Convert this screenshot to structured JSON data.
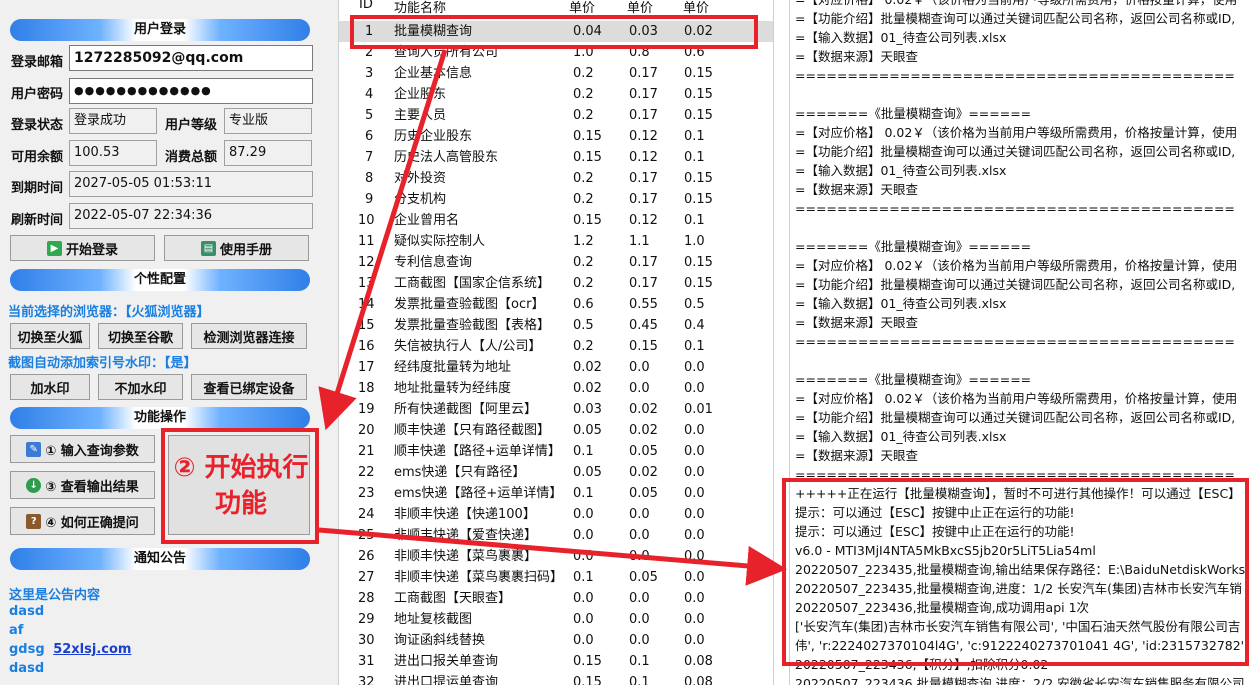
{
  "login": {
    "title": "用户登录",
    "email_label": "登录邮箱",
    "email_value": "1272285092@qq.com",
    "password_label": "用户密码",
    "password_value": "●●●●●●●●●●●●●",
    "status_label": "登录状态",
    "status_value": "登录成功",
    "level_label": "用户等级",
    "level_value": "专业版",
    "balance_label": "可用余额",
    "balance_value": "100.53",
    "spent_label": "消费总额",
    "spent_value": "87.29",
    "expire_label": "到期时间",
    "expire_value": "2027-05-05 01:53:11",
    "refresh_label": "刷新时间",
    "refresh_value": "2022-05-07 22:34:36",
    "start_login_btn": "开始登录",
    "manual_btn": "使用手册"
  },
  "personal": {
    "title": "个性配置",
    "browser_line": "当前选择的浏览器：【火狐浏览器】",
    "switch_firefox": "切换至火狐",
    "switch_chrome": "切换至谷歌",
    "detect_browser": "检测浏览器连接",
    "watermark_line": "截图自动添加索引号水印：【是】",
    "add_watermark": "加水印",
    "no_watermark": "不加水印",
    "view_devices": "查看已绑定设备"
  },
  "functions": {
    "title": "功能操作",
    "input_params": "① 输入查询参数",
    "view_output": "③ 查看输出结果",
    "how_to_ask": "④ 如何正确提问",
    "start_exec": "② 开始执行功能"
  },
  "notice": {
    "title": "通知公告",
    "content_label": "这里是公告内容",
    "lines": [
      "dasd",
      "af",
      "gdsg",
      "dasd"
    ],
    "link": "52xlsj.com"
  },
  "table": {
    "headers": [
      "ID",
      "功能名称",
      "单价",
      "单价",
      "单价"
    ],
    "rows": [
      [
        "1",
        "批量模糊查询",
        "0.04",
        "0.03",
        "0.02"
      ],
      [
        "2",
        "查询人员所有公司",
        "1.0",
        "0.8",
        "0.6"
      ],
      [
        "3",
        "企业基本信息",
        "0.2",
        "0.17",
        "0.15"
      ],
      [
        "4",
        "企业股东",
        "0.2",
        "0.17",
        "0.15"
      ],
      [
        "5",
        "主要人员",
        "0.2",
        "0.17",
        "0.15"
      ],
      [
        "6",
        "历史企业股东",
        "0.15",
        "0.12",
        "0.1"
      ],
      [
        "7",
        "历史法人高管股东",
        "0.15",
        "0.12",
        "0.1"
      ],
      [
        "8",
        "对外投资",
        "0.2",
        "0.17",
        "0.15"
      ],
      [
        "9",
        "分支机构",
        "0.2",
        "0.17",
        "0.15"
      ],
      [
        "10",
        "企业曾用名",
        "0.15",
        "0.12",
        "0.1"
      ],
      [
        "11",
        "疑似实际控制人",
        "1.2",
        "1.1",
        "1.0"
      ],
      [
        "12",
        "专利信息查询",
        "0.2",
        "0.17",
        "0.15"
      ],
      [
        "13",
        "工商截图【国家企信系统】",
        "0.2",
        "0.17",
        "0.15"
      ],
      [
        "14",
        "发票批量查验截图【ocr】",
        "0.6",
        "0.55",
        "0.5"
      ],
      [
        "15",
        "发票批量查验截图【表格】",
        "0.5",
        "0.45",
        "0.4"
      ],
      [
        "16",
        "失信被执行人【人/公司】",
        "0.2",
        "0.15",
        "0.1"
      ],
      [
        "17",
        "经纬度批量转为地址",
        "0.02",
        "0.0",
        "0.0"
      ],
      [
        "18",
        "地址批量转为经纬度",
        "0.02",
        "0.0",
        "0.0"
      ],
      [
        "19",
        "所有快递截图【阿里云】",
        "0.03",
        "0.02",
        "0.01"
      ],
      [
        "20",
        "顺丰快递【只有路径截图】",
        "0.05",
        "0.02",
        "0.0"
      ],
      [
        "21",
        "顺丰快递【路径+运单详情】",
        "0.1",
        "0.05",
        "0.0"
      ],
      [
        "22",
        "ems快递【只有路径】",
        "0.05",
        "0.02",
        "0.0"
      ],
      [
        "23",
        "ems快递【路径+运单详情】",
        "0.1",
        "0.05",
        "0.0"
      ],
      [
        "24",
        "非顺丰快递【快递100】",
        "0.0",
        "0.0",
        "0.0"
      ],
      [
        "25",
        "非顺丰快递【爱查快递】",
        "0.0",
        "0.0",
        "0.0"
      ],
      [
        "26",
        "非顺丰快递【菜鸟裹裹】",
        "0.0",
        "0.0",
        "0.0"
      ],
      [
        "27",
        "非顺丰快递【菜鸟裹裹扫码】",
        "0.1",
        "0.05",
        "0.0"
      ],
      [
        "28",
        "工商截图【天眼查】",
        "0.0",
        "0.0",
        "0.0"
      ],
      [
        "29",
        "地址复核截图",
        "0.0",
        "0.0",
        "0.0"
      ],
      [
        "30",
        "询证函斜线替换",
        "0.0",
        "0.0",
        "0.0"
      ],
      [
        "31",
        "进出口报关单查询",
        "0.15",
        "0.1",
        "0.08"
      ],
      [
        "32",
        "进出口提运单查询",
        "0.15",
        "0.1",
        "0.08"
      ]
    ]
  },
  "log": {
    "lines": [
      "=【对应价格】 0.02￥（该价格为当前用户等级所需费用，价格按量计算，使用",
      "=【功能介绍】批量模糊查询可以通过关键词匹配公司名称，返回公司名称或ID,",
      "=【输入数据】01_待查公司列表.xlsx",
      "=【数据来源】天眼查",
      "==========================================",
      "",
      "=======《批量模糊查询》======",
      "=【对应价格】 0.02￥（该价格为当前用户等级所需费用，价格按量计算，使用",
      "=【功能介绍】批量模糊查询可以通过关键词匹配公司名称，返回公司名称或ID,",
      "=【输入数据】01_待查公司列表.xlsx",
      "=【数据来源】天眼查",
      "==========================================",
      "",
      "=======《批量模糊查询》======",
      "=【对应价格】 0.02￥（该价格为当前用户等级所需费用，价格按量计算，使用",
      "=【功能介绍】批量模糊查询可以通过关键词匹配公司名称，返回公司名称或ID,",
      "=【输入数据】01_待查公司列表.xlsx",
      "=【数据来源】天眼查",
      "==========================================",
      "",
      "=======《批量模糊查询》======",
      "=【对应价格】 0.02￥（该价格为当前用户等级所需费用，价格按量计算，使用",
      "=【功能介绍】批量模糊查询可以通过关键词匹配公司名称，返回公司名称或ID,",
      "=【输入数据】01_待查公司列表.xlsx",
      "=【数据来源】天眼查",
      "==========================================",
      "+++++正在运行【批量模糊查询】，暂时不可进行其他操作！可以通过【ESC】",
      "提示：可以通过【ESC】按键中止正在运行的功能!",
      "提示：可以通过【ESC】按键中止正在运行的功能!",
      "v6.0 - MTI3MjI4NTA5MkBxcS5jb20r5LiT5Lia54ml",
      "20220507_223435,批量模糊查询,输出结果保存路径：E:\\BaiduNetdiskWorks",
      "20220507_223435,批量模糊查询,进度：1/2 长安汽车(集团)吉林市长安汽车销",
      "20220507_223436,批量模糊查询,成功调用api 1次",
      "['长安汽车(集团)吉林市长安汽车销售有限公司', '中国石油天然气股份有限公司吉",
      "伟', 'r:2224027370104l4G', 'c:9122240273701041 4G', 'id:2315732782', '",
      "20220507_223436,【积分】,扣除积分0.02",
      "20220507_223436,批量模糊查询,进度：2/2 安徽省长安汽车销售服务有限公司"
    ]
  },
  "colors": {
    "annotation_red": "#e8222b",
    "link_blue": "#1a7fe0"
  }
}
